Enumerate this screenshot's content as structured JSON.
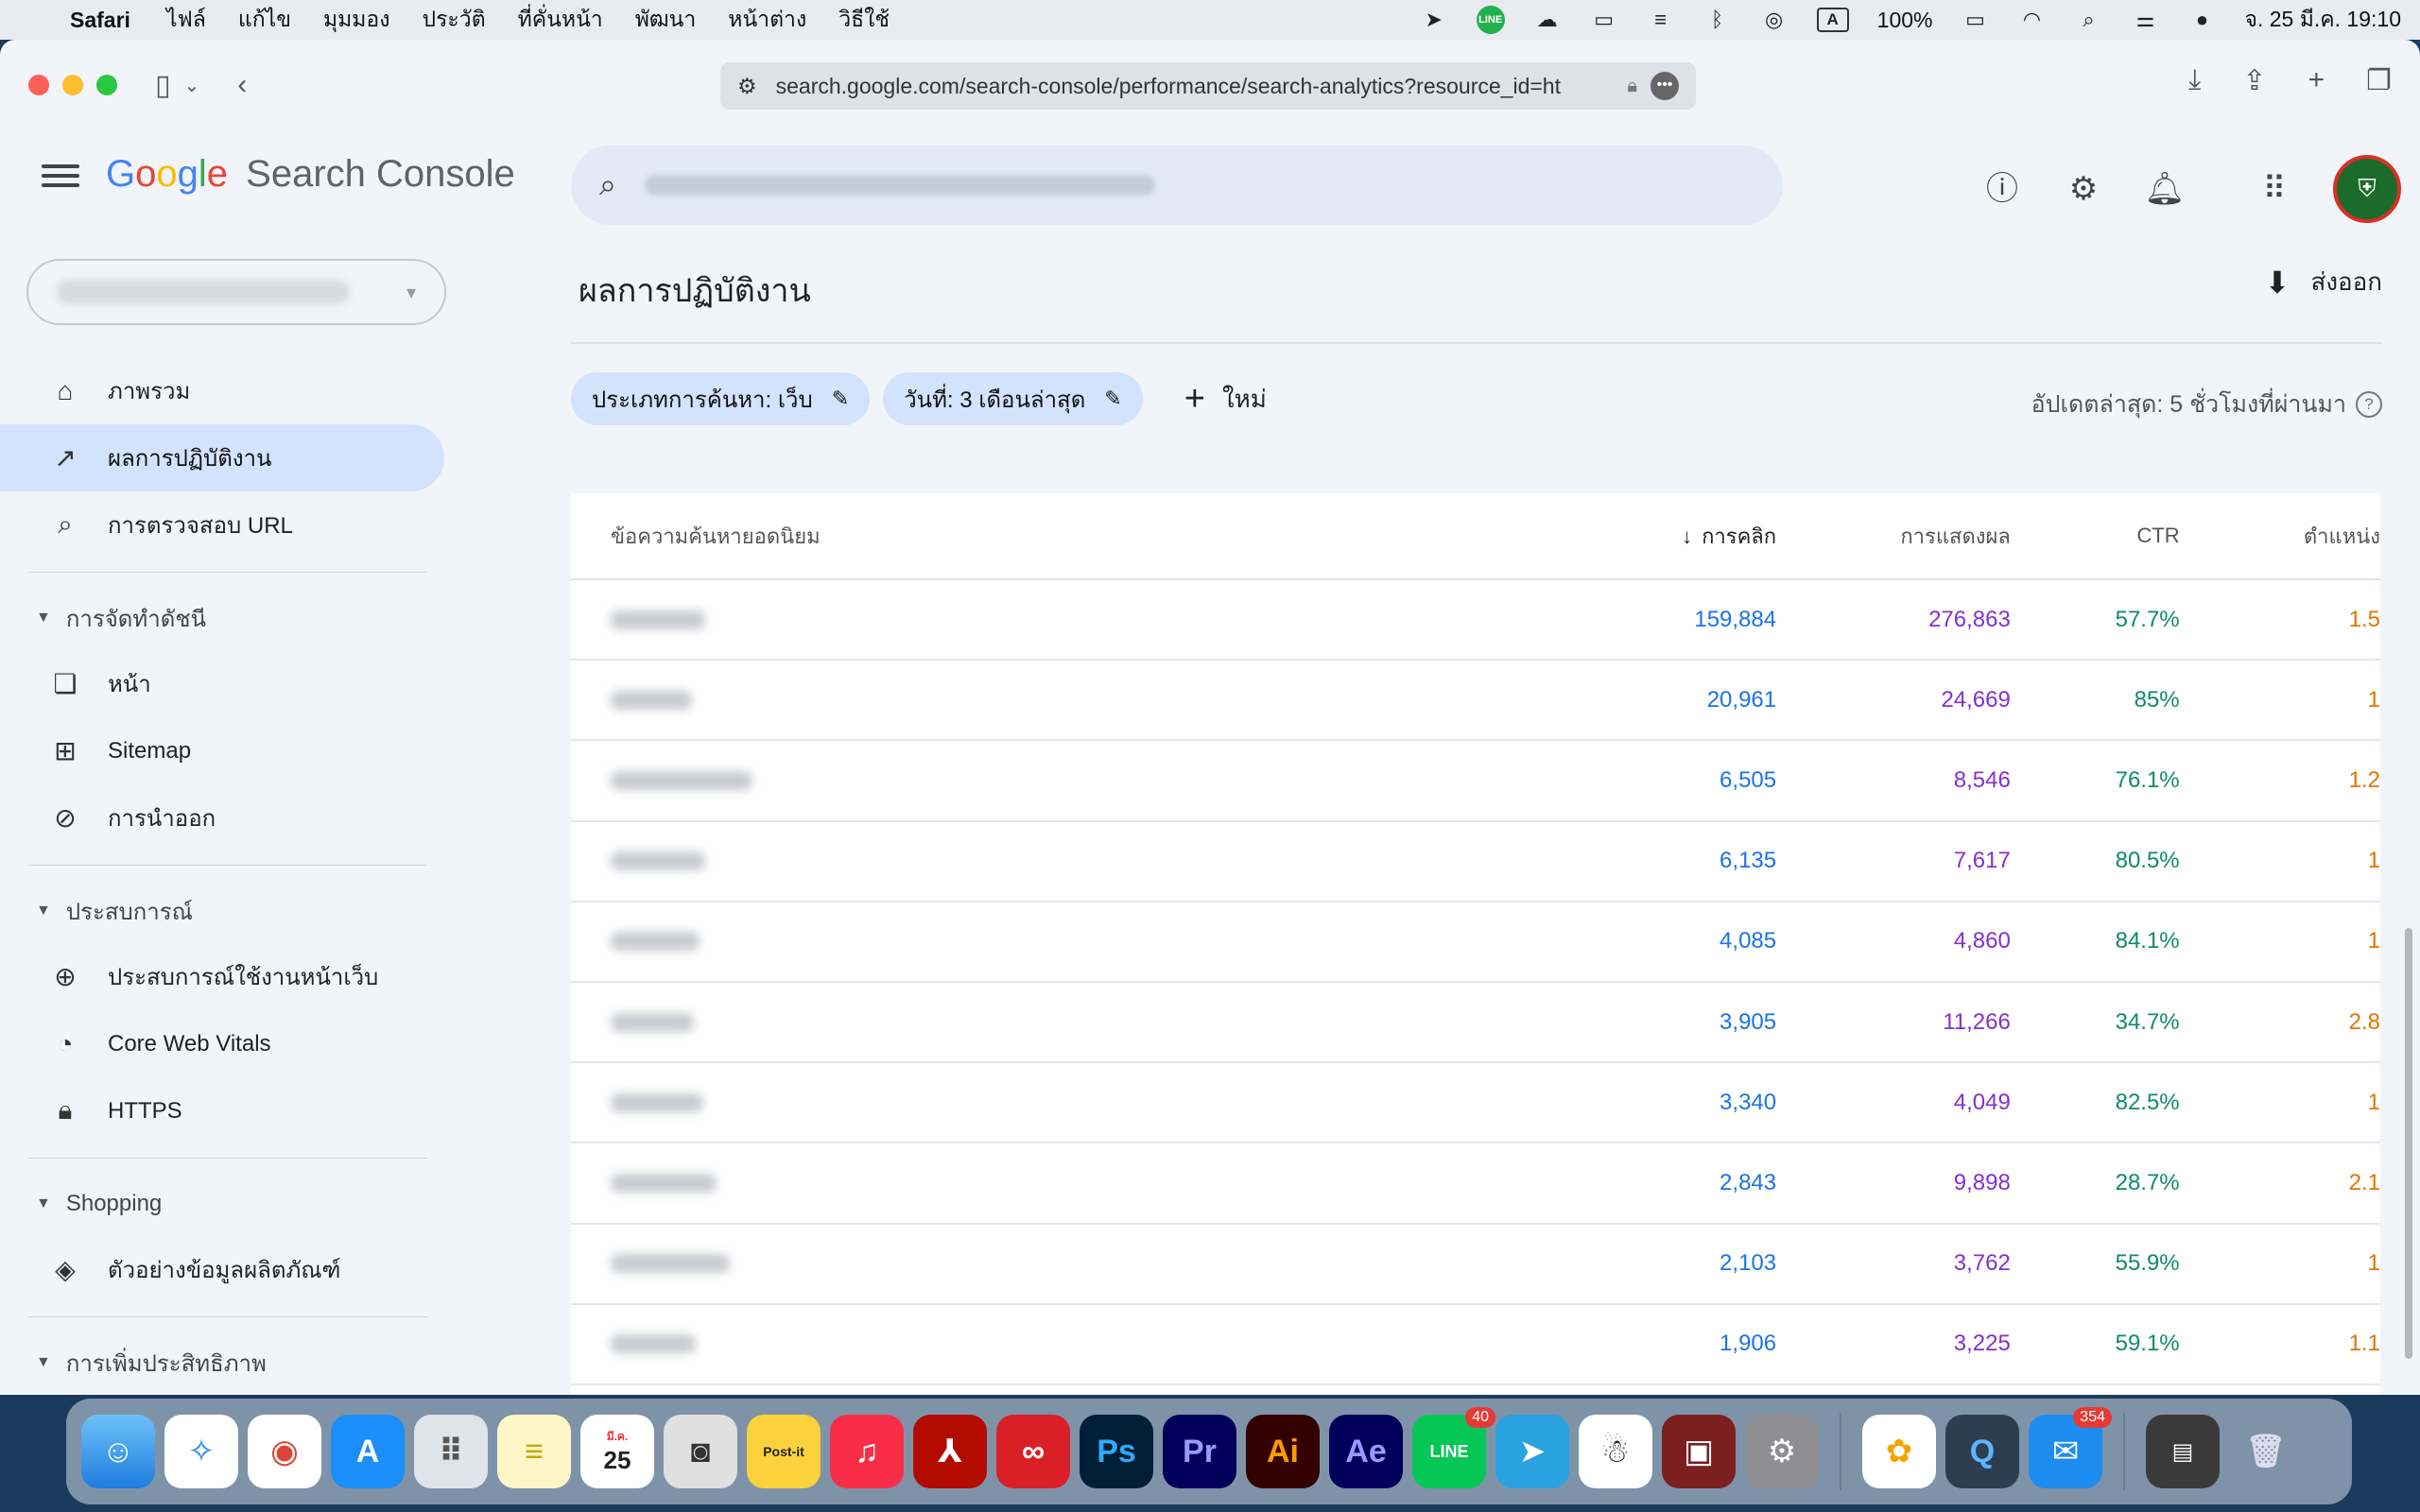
{
  "menubar": {
    "app": "Safari",
    "items": [
      "ไฟล์",
      "แก้ไข",
      "มุมมอง",
      "ประวัติ",
      "ที่คั่นหน้า",
      "พัฒนา",
      "หน้าต่าง",
      "วิธีใช้"
    ],
    "input_method": "A",
    "battery": "100%",
    "datetime": "จ. 25 มี.ค. 19:10"
  },
  "browser": {
    "url": "search.google.com/search-console/performance/search-analytics?resource_id=ht"
  },
  "header": {
    "product": "Search Console"
  },
  "sidebar": {
    "items": [
      {
        "label": "ภาพรวม",
        "icon": "home-icon"
      },
      {
        "label": "ผลการปฏิบัติงาน",
        "icon": "trending-up-icon",
        "active": true
      },
      {
        "label": "การตรวจสอบ URL",
        "icon": "search-icon"
      }
    ],
    "sections": [
      {
        "title": "การจัดทำดัชนี",
        "items": [
          {
            "label": "หน้า",
            "icon": "pages-icon"
          },
          {
            "label": "Sitemap",
            "icon": "sitemap-icon"
          },
          {
            "label": "การนำออก",
            "icon": "eye-off-icon"
          }
        ]
      },
      {
        "title": "ประสบการณ์",
        "items": [
          {
            "label": "ประสบการณ์ใช้งานหน้าเว็บ",
            "icon": "plus-circle-icon"
          },
          {
            "label": "Core Web Vitals",
            "icon": "speed-icon"
          },
          {
            "label": "HTTPS",
            "icon": "lock-icon"
          }
        ]
      },
      {
        "title": "Shopping",
        "items": [
          {
            "label": "ตัวอย่างข้อมูลผลิตภัณฑ์",
            "icon": "layers-icon"
          }
        ]
      },
      {
        "title": "การเพิ่มประสิทธิภาพ",
        "items": []
      }
    ]
  },
  "main": {
    "title": "ผลการปฏิบัติงาน",
    "export_label": "ส่งออก",
    "filters": [
      {
        "label": "ประเภทการค้นหา: เว็บ"
      },
      {
        "label": "วันที่: 3 เดือนล่าสุด"
      }
    ],
    "new_label": "ใหม่",
    "updated": "อัปเดตล่าสุด: 5 ชั่วโมงที่ผ่านมา",
    "table": {
      "headers": {
        "query": "ข้อความค้นหายอดนิยม",
        "clicks": "การคลิก",
        "impressions": "การแสดงผล",
        "ctr": "CTR",
        "position": "ตำแหน่ง"
      },
      "rows": [
        {
          "clicks": "159,884",
          "impressions": "276,863",
          "ctr": "57.7%",
          "position": "1.5"
        },
        {
          "clicks": "20,961",
          "impressions": "24,669",
          "ctr": "85%",
          "position": "1"
        },
        {
          "clicks": "6,505",
          "impressions": "8,546",
          "ctr": "76.1%",
          "position": "1.2"
        },
        {
          "clicks": "6,135",
          "impressions": "7,617",
          "ctr": "80.5%",
          "position": "1"
        },
        {
          "clicks": "4,085",
          "impressions": "4,860",
          "ctr": "84.1%",
          "position": "1"
        },
        {
          "clicks": "3,905",
          "impressions": "11,266",
          "ctr": "34.7%",
          "position": "2.8"
        },
        {
          "clicks": "3,340",
          "impressions": "4,049",
          "ctr": "82.5%",
          "position": "1"
        },
        {
          "clicks": "2,843",
          "impressions": "9,898",
          "ctr": "28.7%",
          "position": "2.1"
        },
        {
          "clicks": "2,103",
          "impressions": "3,762",
          "ctr": "55.9%",
          "position": "1"
        },
        {
          "clicks": "1,906",
          "impressions": "3,225",
          "ctr": "59.1%",
          "position": "1.1"
        }
      ]
    }
  },
  "dock": {
    "calendar_month": "มี.ค.",
    "calendar_day": "25",
    "line_badge": "40",
    "mail_badge": "354",
    "apps": [
      "Finder",
      "Safari",
      "Chrome",
      "App Store",
      "Launchpad",
      "Notes",
      "Calendar",
      "Screenshot",
      "Post-it",
      "Music",
      "Acrobat",
      "Creative Cloud",
      "Photoshop",
      "Premiere Pro",
      "Illustrator",
      "After Effects",
      "LINE",
      "Telegram",
      "Voice",
      "Photo Booth",
      "System Settings",
      "Photos",
      "QuickTime",
      "Mail",
      "Finder Window",
      "Trash"
    ]
  },
  "colors": {
    "clicks": "#1a73e8",
    "impressions": "#8430ce",
    "ctr": "#0f8a6e",
    "position": "#e37400",
    "active_nav": "#d3e3fd"
  }
}
